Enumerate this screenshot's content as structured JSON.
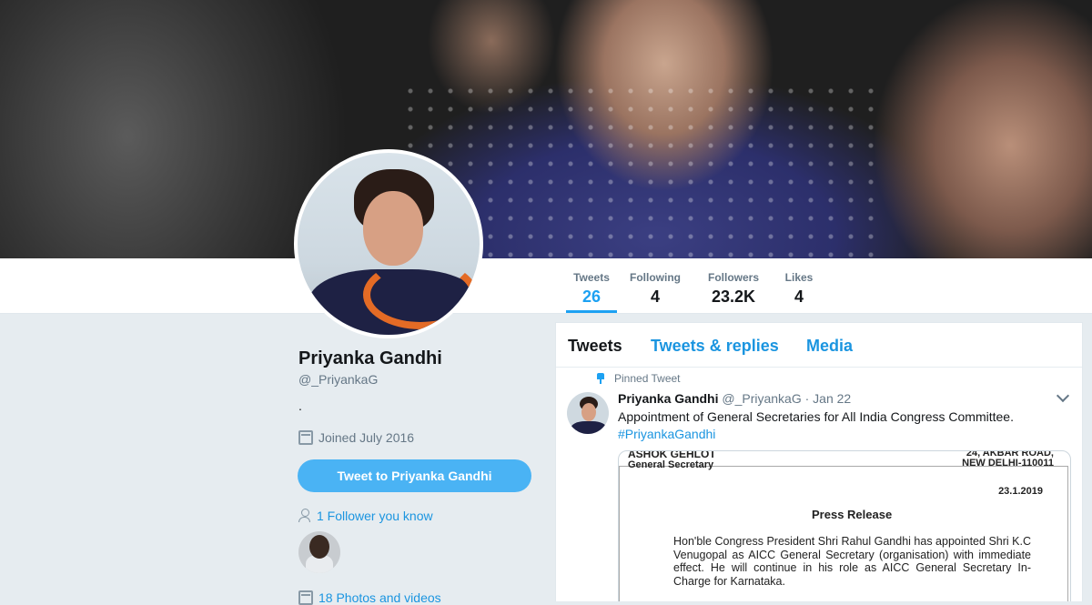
{
  "profile": {
    "name": "Priyanka Gandhi",
    "handle": "@_PriyankaG",
    "bio": ".",
    "joined": "Joined July 2016",
    "tweet_to_label": "Tweet to Priyanka Gandhi",
    "followers_you_know": "1 Follower you know",
    "photos_videos": "18 Photos and videos"
  },
  "stats": [
    {
      "label": "Tweets",
      "value": "26"
    },
    {
      "label": "Following",
      "value": "4"
    },
    {
      "label": "Followers",
      "value": "23.2K"
    },
    {
      "label": "Likes",
      "value": "4"
    }
  ],
  "timeline": {
    "tabs": [
      "Tweets",
      "Tweets & replies",
      "Media"
    ],
    "pinned_label": "Pinned Tweet",
    "tweet": {
      "name": "Priyanka Gandhi",
      "handle": "@_PriyankaG",
      "date": "· Jan 22",
      "text": "Appointment of General Secretaries for All India Congress Committee.",
      "hashtag": "#PriyankaGandhi"
    },
    "document": {
      "sender_name": "ASHOK GEHLOT",
      "sender_title": "General Secretary",
      "address_line1": "24, AKBAR ROAD,",
      "address_line2": "NEW DELHI-110011",
      "date": "23.1.2019",
      "heading": "Press Release",
      "body": "Hon'ble Congress President Shri Rahul Gandhi has appointed Shri K.C Venugopal as AICC General Secretary (organisation) with immediate effect. He will continue in his role as AICC General Secretary In-Charge for Karnataka."
    }
  },
  "colors": {
    "accent": "#1da1f2",
    "link": "#1b95e0",
    "button": "#4ab3f4",
    "page_bg": "#e6ecf0"
  },
  "icons": [
    "calendar-icon",
    "person-icon",
    "photo-icon",
    "pin-icon",
    "chevron-down-icon"
  ]
}
